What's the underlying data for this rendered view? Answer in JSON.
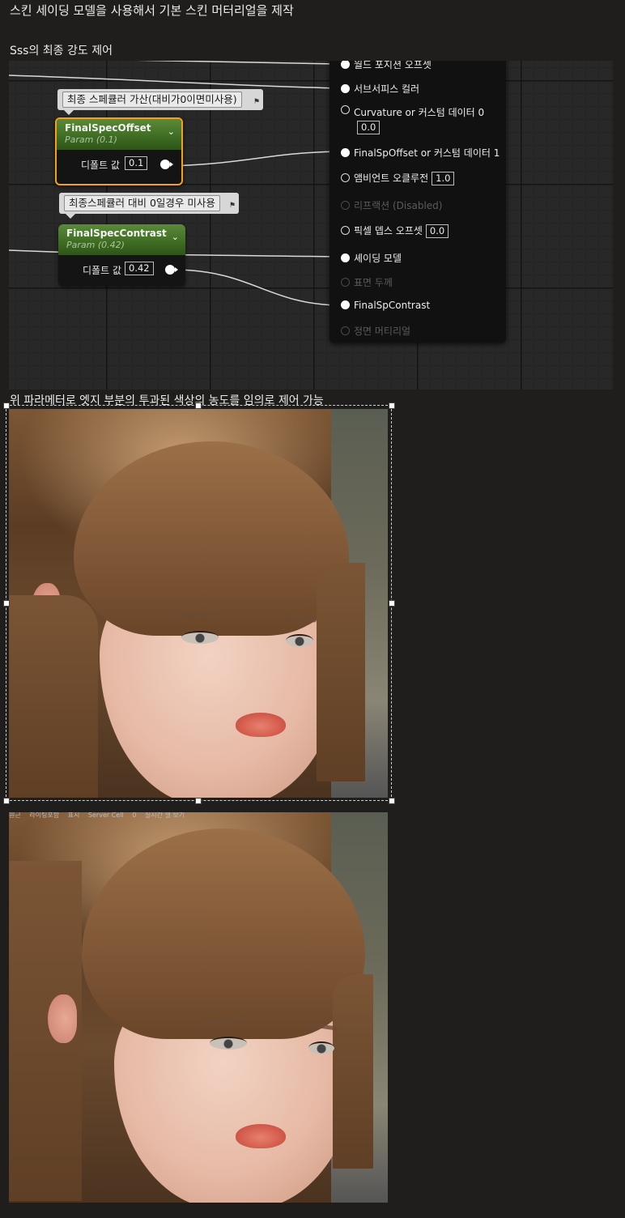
{
  "headings": {
    "title": "스킨 세이딩 모델을 사용해서 기본 스킨 머터리얼을 제작",
    "sss": "Sss의 최종 강도 제어",
    "caption": "위 파라메터로 엣지 부분의 투과된 색상의 농도를 임의로 제어 가능"
  },
  "graph": {
    "comments": [
      "최종 스페큘러 가산(대비가0이면미사용)",
      "최종스페큘러 대비 0일경우 미사용"
    ],
    "nodes": [
      {
        "title": "FinalSpecOffset",
        "subtitle": "Param (0.1)",
        "value_label": "디폴트 값",
        "value": "0.1"
      },
      {
        "title": "FinalSpecContrast",
        "subtitle": "Param (0.42)",
        "value_label": "디폴트 값",
        "value": "0.42"
      }
    ],
    "result_pins": [
      {
        "label": "월드 포지션 오프셋",
        "value": ""
      },
      {
        "label": "서브서피스 컬러",
        "value": ""
      },
      {
        "label": "Curvature or 커스텀 데이터 0",
        "value": "0.0"
      },
      {
        "label": "FinalSpOffset or 커스텀 데이터 1",
        "value": ""
      },
      {
        "label": "앰비언트 오클루전",
        "value": "1.0"
      },
      {
        "label": "리프랙션 (Disabled)",
        "value": ""
      },
      {
        "label": "픽셀 뎁스 오프셋",
        "value": "0.0"
      },
      {
        "label": "셰이딩 모델",
        "value": ""
      },
      {
        "label": "표면 두께",
        "value": ""
      },
      {
        "label": "FinalSpContrast",
        "value": ""
      },
      {
        "label": "정면 머티리얼",
        "value": ""
      }
    ]
  },
  "viewport_toolbar": {
    "items": [
      "원근",
      "라이팅포함",
      "표시",
      "Server Cell",
      "0",
      "실시간 셀 보기"
    ]
  },
  "colors": {
    "page_bg": "#1f1e1d",
    "selection_outline": "#f5a11b",
    "param_header": "#4f7d31"
  }
}
